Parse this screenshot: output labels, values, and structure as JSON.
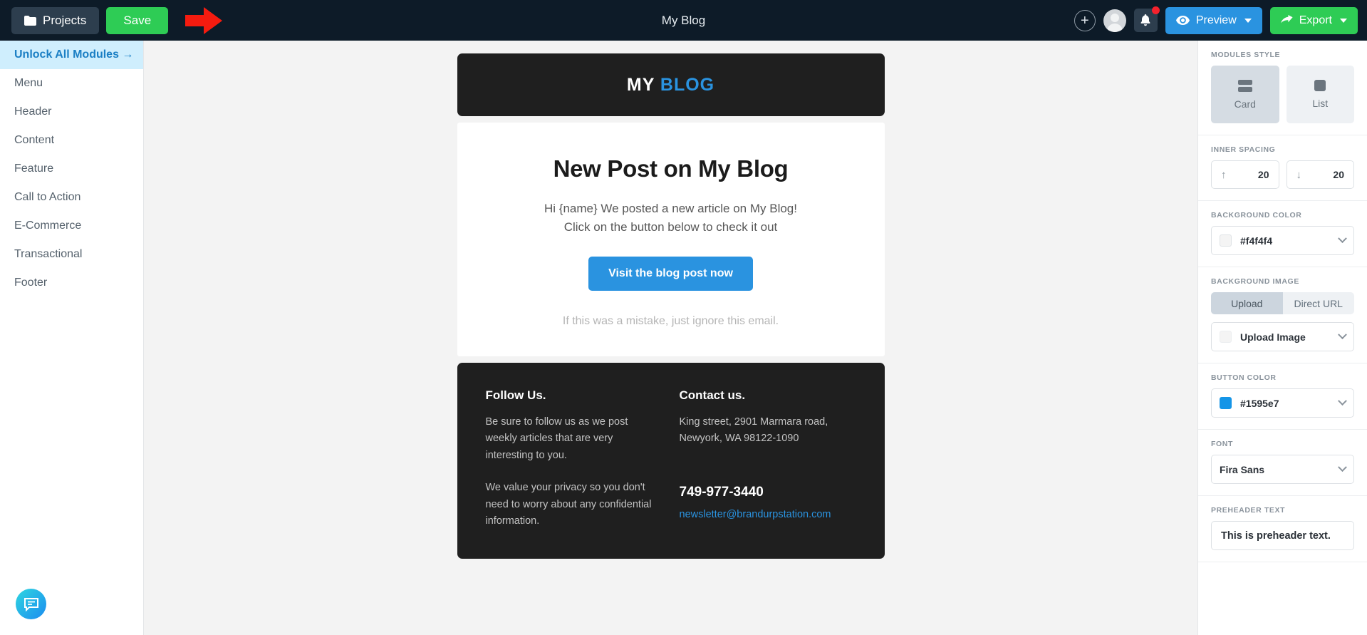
{
  "topbar": {
    "projects_label": "Projects",
    "save_label": "Save",
    "title": "My Blog",
    "add_label": "+",
    "preview_label": "Preview",
    "export_label": "Export"
  },
  "sidebar": {
    "items": [
      {
        "label": "Unlock All Modules →",
        "highlight": true
      },
      {
        "label": "Menu",
        "highlight": false
      },
      {
        "label": "Header",
        "highlight": false
      },
      {
        "label": "Content",
        "highlight": false
      },
      {
        "label": "Feature",
        "highlight": false
      },
      {
        "label": "Call to Action",
        "highlight": false
      },
      {
        "label": "E-Commerce",
        "highlight": false
      },
      {
        "label": "Transactional",
        "highlight": false
      },
      {
        "label": "Footer",
        "highlight": false
      }
    ]
  },
  "email": {
    "logo_first": "MY",
    "logo_second": "BLOG",
    "heading": "New Post on My Blog",
    "paragraph_line1": "Hi {name} We posted a new article on My Blog!",
    "paragraph_line2": "Click on the button below to check it out",
    "cta_label": "Visit the blog post now",
    "note": "If this was a mistake, just ignore this email.",
    "footer": {
      "left_heading": "Follow Us.",
      "left_text_1": "Be sure to follow us as we post weekly articles that are very interesting to you.",
      "left_text_2": "We value your privacy so you don't need to worry about any confidential information.",
      "right_heading": "Contact us.",
      "address_line1": "King street, 2901 Marmara road,",
      "address_line2": "Newyork, WA 98122-1090",
      "phone": "749-977-3440",
      "email": "newsletter@brandurpstation.com"
    }
  },
  "panel": {
    "modules_style_label": "MODULES STYLE",
    "card_label": "Card",
    "list_label": "List",
    "inner_spacing_label": "INNER SPACING",
    "spacing_top": "20",
    "spacing_bottom": "20",
    "background_color_label": "BACKGROUND COLOR",
    "background_color_value": "#f4f4f4",
    "background_image_label": "BACKGROUND IMAGE",
    "upload_tab": "Upload",
    "direct_url_tab": "Direct URL",
    "upload_image_value": "Upload Image",
    "button_color_label": "BUTTON COLOR",
    "button_color_value": "#1595e7",
    "font_label": "FONT",
    "font_value": "Fira Sans",
    "preheader_label": "PREHEADER TEXT",
    "preheader_value": "This is preheader text."
  },
  "colors": {
    "topbar_bg": "#0d1b28",
    "save_green": "#2ecc55",
    "preview_blue": "#2a93e0",
    "accent_blue": "#1595e7",
    "email_dark": "#1f1f1f",
    "canvas_bg": "#f3f3f3",
    "highlight_blue": "#cfeefd",
    "annotation_red": "#f51b0f"
  }
}
